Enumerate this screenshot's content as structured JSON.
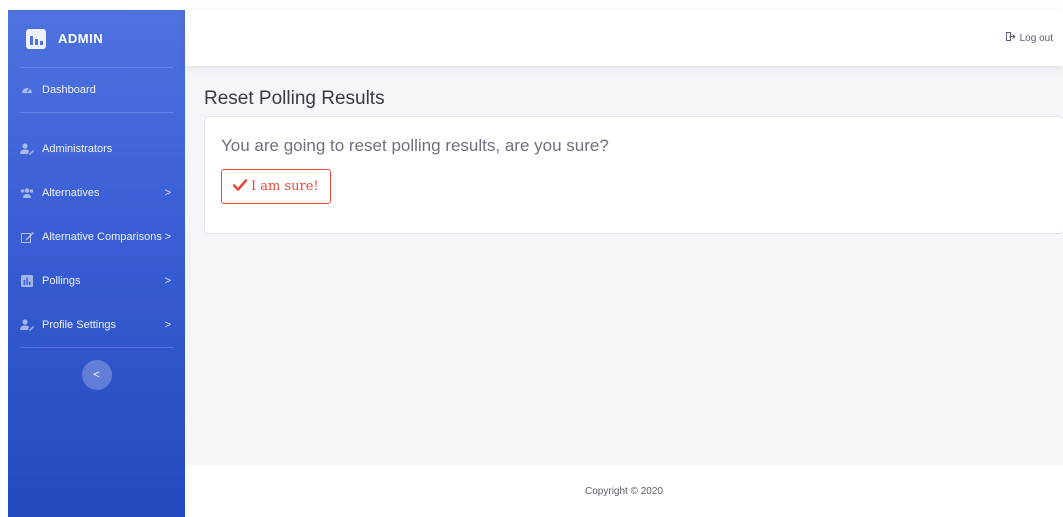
{
  "sidebar": {
    "brand": "ADMIN",
    "items": [
      {
        "label": "Dashboard",
        "icon": "tachometer-icon",
        "has_chevron": false
      },
      {
        "label": "Administrators",
        "icon": "user-edit-icon",
        "has_chevron": false
      },
      {
        "label": "Alternatives",
        "icon": "users-icon",
        "has_chevron": true
      },
      {
        "label": "Alternative Comparisons",
        "icon": "edit-icon",
        "has_chevron": true
      },
      {
        "label": "Pollings",
        "icon": "poll-icon",
        "has_chevron": true
      },
      {
        "label": "Profile Settings",
        "icon": "user-cog-icon",
        "has_chevron": true
      }
    ],
    "chevron": ">",
    "toggle": "<"
  },
  "topbar": {
    "logout_label": "Log out"
  },
  "main": {
    "title": "Reset Polling Results",
    "card_text": "You are going to reset polling results, are you sure?",
    "confirm_label": "I am sure!"
  },
  "footer": {
    "copyright": "Copyright © 2020"
  },
  "colors": {
    "sidebar_top": "#4e73df",
    "sidebar_bottom": "#224abe",
    "danger": "#e74a3b",
    "content_bg": "#f5f6fa"
  }
}
